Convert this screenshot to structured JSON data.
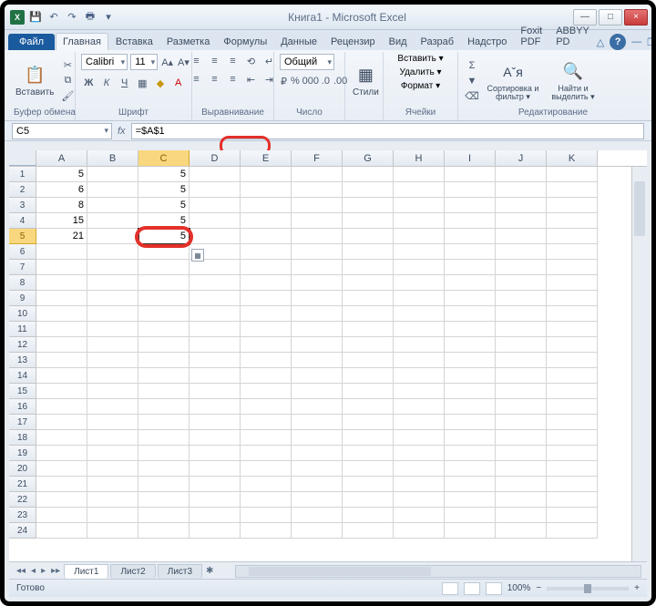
{
  "window": {
    "title": "Книга1 - Microsoft Excel",
    "min": "—",
    "max": "□",
    "close": "×"
  },
  "tabs": {
    "file": "Файл",
    "items": [
      "Главная",
      "Вставка",
      "Разметка",
      "Формулы",
      "Данные",
      "Рецензир",
      "Вид",
      "Разраб",
      "Надстро",
      "Foxit PDF",
      "ABBYY PD"
    ]
  },
  "ribbon": {
    "paste": "Вставить",
    "clipboard": "Буфер обмена",
    "font_name": "Calibri",
    "font_size": "11",
    "font_group": "Шрифт",
    "align_group": "Выравнивание",
    "number_format": "Общий",
    "number_group": "Число",
    "styles": "Стили",
    "cells": {
      "insert": "Вставить ▾",
      "delete": "Удалить ▾",
      "format": "Формат ▾",
      "group": "Ячейки"
    },
    "editing": {
      "sort": "Сортировка и фильтр ▾",
      "find": "Найти и выделить ▾",
      "group": "Редактирование"
    }
  },
  "formula_bar": {
    "name_box": "C5",
    "fx": "fx",
    "formula": "=$A$1"
  },
  "columns": [
    "A",
    "B",
    "C",
    "D",
    "E",
    "F",
    "G",
    "H",
    "I",
    "J",
    "K"
  ],
  "selected_col": "C",
  "selected_row": 5,
  "rows_count": 24,
  "cells": {
    "A1": "5",
    "C1": "5",
    "A2": "6",
    "C2": "5",
    "A3": "8",
    "C3": "5",
    "A4": "15",
    "C4": "5",
    "A5": "21",
    "C5": "5"
  },
  "sheets": {
    "nav": [
      "◂◂",
      "◂",
      "▸",
      "▸▸"
    ],
    "tabs": [
      "Лист1",
      "Лист2",
      "Лист3"
    ],
    "new": "✱"
  },
  "status": {
    "ready": "Готово",
    "zoom": "100%",
    "minus": "−",
    "plus": "+"
  }
}
